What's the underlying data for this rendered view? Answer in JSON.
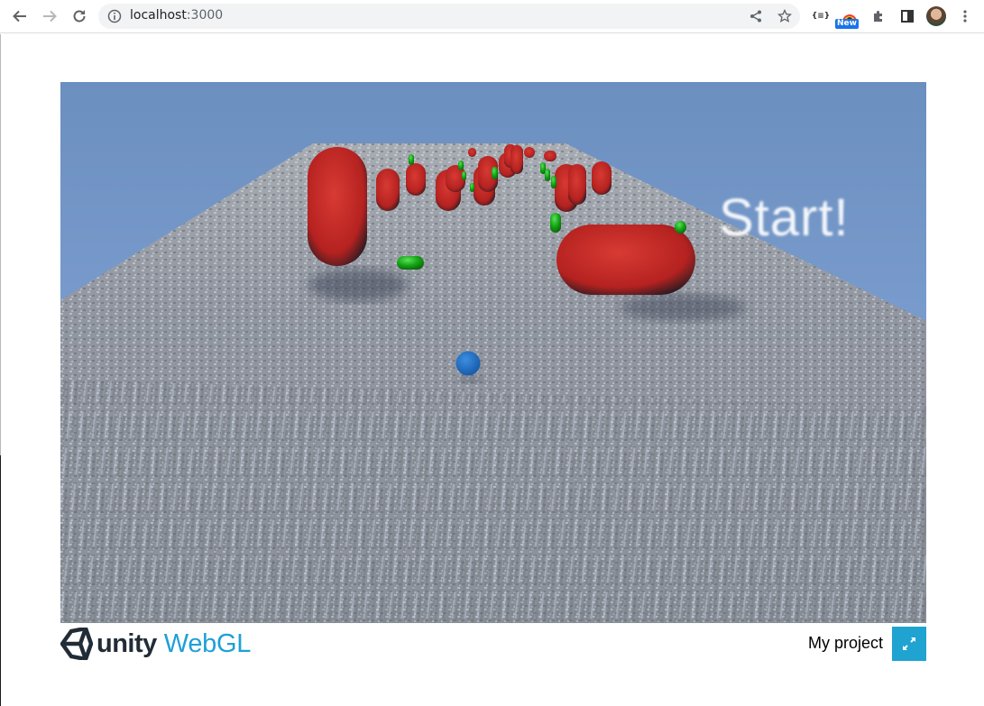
{
  "browser": {
    "url_host": "localhost",
    "url_port": ":3000",
    "extension_badge": "New",
    "icons": {
      "back": "arrow-left-icon",
      "forward": "arrow-right-icon",
      "reload": "reload-icon",
      "site_info": "info-icon",
      "share": "share-icon",
      "bookmark": "star-icon",
      "json_viewer": "json-braces-icon",
      "extension_new": "camera-extension-icon",
      "extensions": "puzzle-icon",
      "side_panel": "side-panel-icon",
      "profile": "avatar",
      "menu": "kebab-menu-icon"
    },
    "json_ext_label": "{≡}"
  },
  "game": {
    "overlay_text": "Start!",
    "colors": {
      "sky_top": "#6b8fbf",
      "sky_bottom": "#88a9dd",
      "road": "#8e949c",
      "enemy_capsule": "#c62a2a",
      "pickup_capsule": "#1aa31a",
      "player_ball": "#1f6fc2"
    }
  },
  "footer": {
    "logo_word": "unity",
    "logo_suffix": "WebGL",
    "build_title": "My project",
    "accent_color": "#1fa3d1"
  }
}
